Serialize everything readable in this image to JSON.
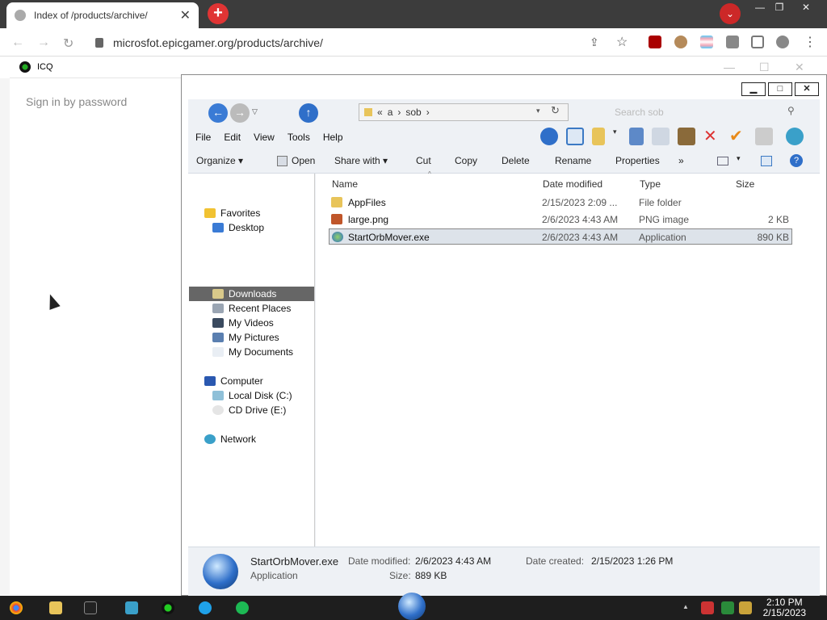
{
  "browser": {
    "tab_title": "Index of /products/archive/",
    "tab_close": "✕",
    "new_tab": "+",
    "address": "microsfot.epicgamer.org/products/archive/",
    "window_controls": [
      "—",
      "❐",
      "✕"
    ],
    "profile_button": "⌄"
  },
  "icq": {
    "title": "ICQ",
    "sign_in": "Sign in by password",
    "controls": [
      "—",
      "☐",
      "✕"
    ]
  },
  "explorer": {
    "caption_buttons": [
      "▁",
      "□",
      "✕"
    ],
    "breadcrumb": [
      "«",
      "a",
      "›",
      "sob",
      "›"
    ],
    "search_placeholder": "Search sob",
    "menu": [
      "File",
      "Edit",
      "View",
      "Tools",
      "Help"
    ],
    "commands": {
      "organize": "Organize ▾",
      "open": "Open",
      "share": "Share with ▾",
      "cut": "Cut",
      "copy": "Copy",
      "delete": "Delete",
      "rename": "Rename",
      "properties": "Properties",
      "more": "»"
    },
    "nav": {
      "favorites": "Favorites",
      "desktop": "Desktop",
      "downloads": "Downloads",
      "recent": "Recent Places",
      "videos": "My Videos",
      "pictures": "My Pictures",
      "documents": "My Documents",
      "computer": "Computer",
      "local_disk": "Local Disk (C:)",
      "cd_drive": "CD Drive (E:)",
      "network": "Network"
    },
    "columns": {
      "name": "Name",
      "date": "Date modified",
      "type": "Type",
      "size": "Size"
    },
    "files": [
      {
        "name": "AppFiles",
        "date": "2/15/2023 2:09 ...",
        "type": "File folder",
        "size": ""
      },
      {
        "name": "large.png",
        "date": "2/6/2023 4:43 AM",
        "type": "PNG image",
        "size": "2 KB"
      },
      {
        "name": "StartOrbMover.exe",
        "date": "2/6/2023 4:43 AM",
        "type": "Application",
        "size": "890 KB"
      }
    ],
    "details": {
      "name": "StartOrbMover.exe",
      "type": "Application",
      "date_modified_label": "Date modified:",
      "date_modified": "2/6/2023 4:43 AM",
      "size_label": "Size:",
      "size": "889 KB",
      "date_created_label": "Date created:",
      "date_created": "2/15/2023 1:26 PM"
    }
  },
  "taskbar": {
    "time": "2:10 PM",
    "date": "2/15/2023",
    "tray_up": "▲"
  }
}
